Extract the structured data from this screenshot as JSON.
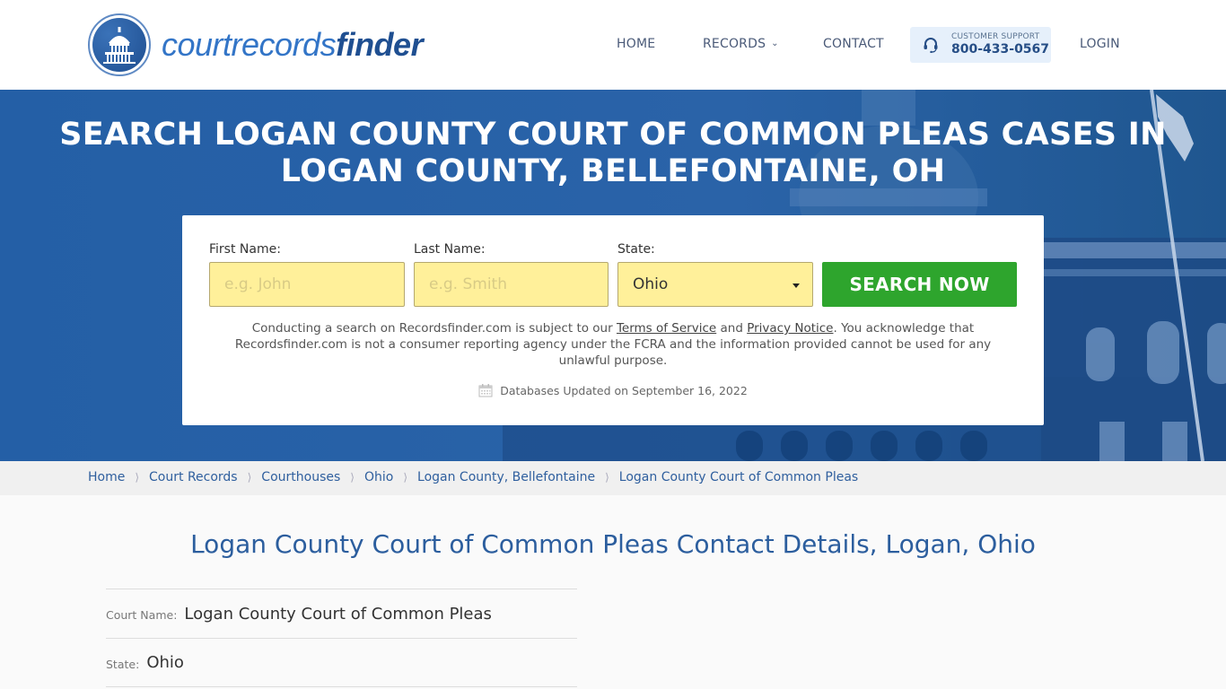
{
  "header": {
    "logo": {
      "part1": "courtrecords",
      "part2": "finder"
    },
    "nav": {
      "home": "HOME",
      "records": "RECORDS",
      "contact": "CONTACT",
      "login": "LOGIN"
    },
    "support": {
      "label": "CUSTOMER SUPPORT",
      "phone": "800-433-0567"
    }
  },
  "hero": {
    "title_line1": "SEARCH LOGAN COUNTY COURT OF COMMON PLEAS CASES IN",
    "title_line2": "LOGAN COUNTY, BELLEFONTAINE, OH"
  },
  "search": {
    "first_name_label": "First Name:",
    "first_name_placeholder": "e.g. John",
    "first_name_value": "",
    "last_name_label": "Last Name:",
    "last_name_placeholder": "e.g. Smith",
    "last_name_value": "",
    "state_label": "State:",
    "state_value": "Ohio",
    "button_label": "SEARCH NOW",
    "disclaimer": {
      "part1": "Conducting a search on Recordsfinder.com is subject to our ",
      "terms_link": "Terms of Service",
      "part2": " and ",
      "privacy_link": "Privacy Notice",
      "part3": ". You acknowledge that Recordsfinder.com is not a consumer reporting agency under the FCRA and the information provided cannot be used for any unlawful purpose."
    },
    "db_updated": "Databases Updated on September 16, 2022"
  },
  "breadcrumb": [
    "Home",
    "Court Records",
    "Courthouses",
    "Ohio",
    "Logan County, Bellefontaine",
    "Logan County Court of Common Pleas"
  ],
  "main": {
    "title": "Logan County Court of Common Pleas Contact Details, Logan, Ohio",
    "details": [
      {
        "label": "Court Name:",
        "value": "Logan County Court of Common Pleas"
      },
      {
        "label": "State:",
        "value": "Ohio"
      }
    ]
  },
  "colors": {
    "brand_blue": "#245fa6",
    "search_green": "#2ea52d",
    "input_yellow": "#fff09a",
    "link_blue": "#2f5f9e"
  }
}
